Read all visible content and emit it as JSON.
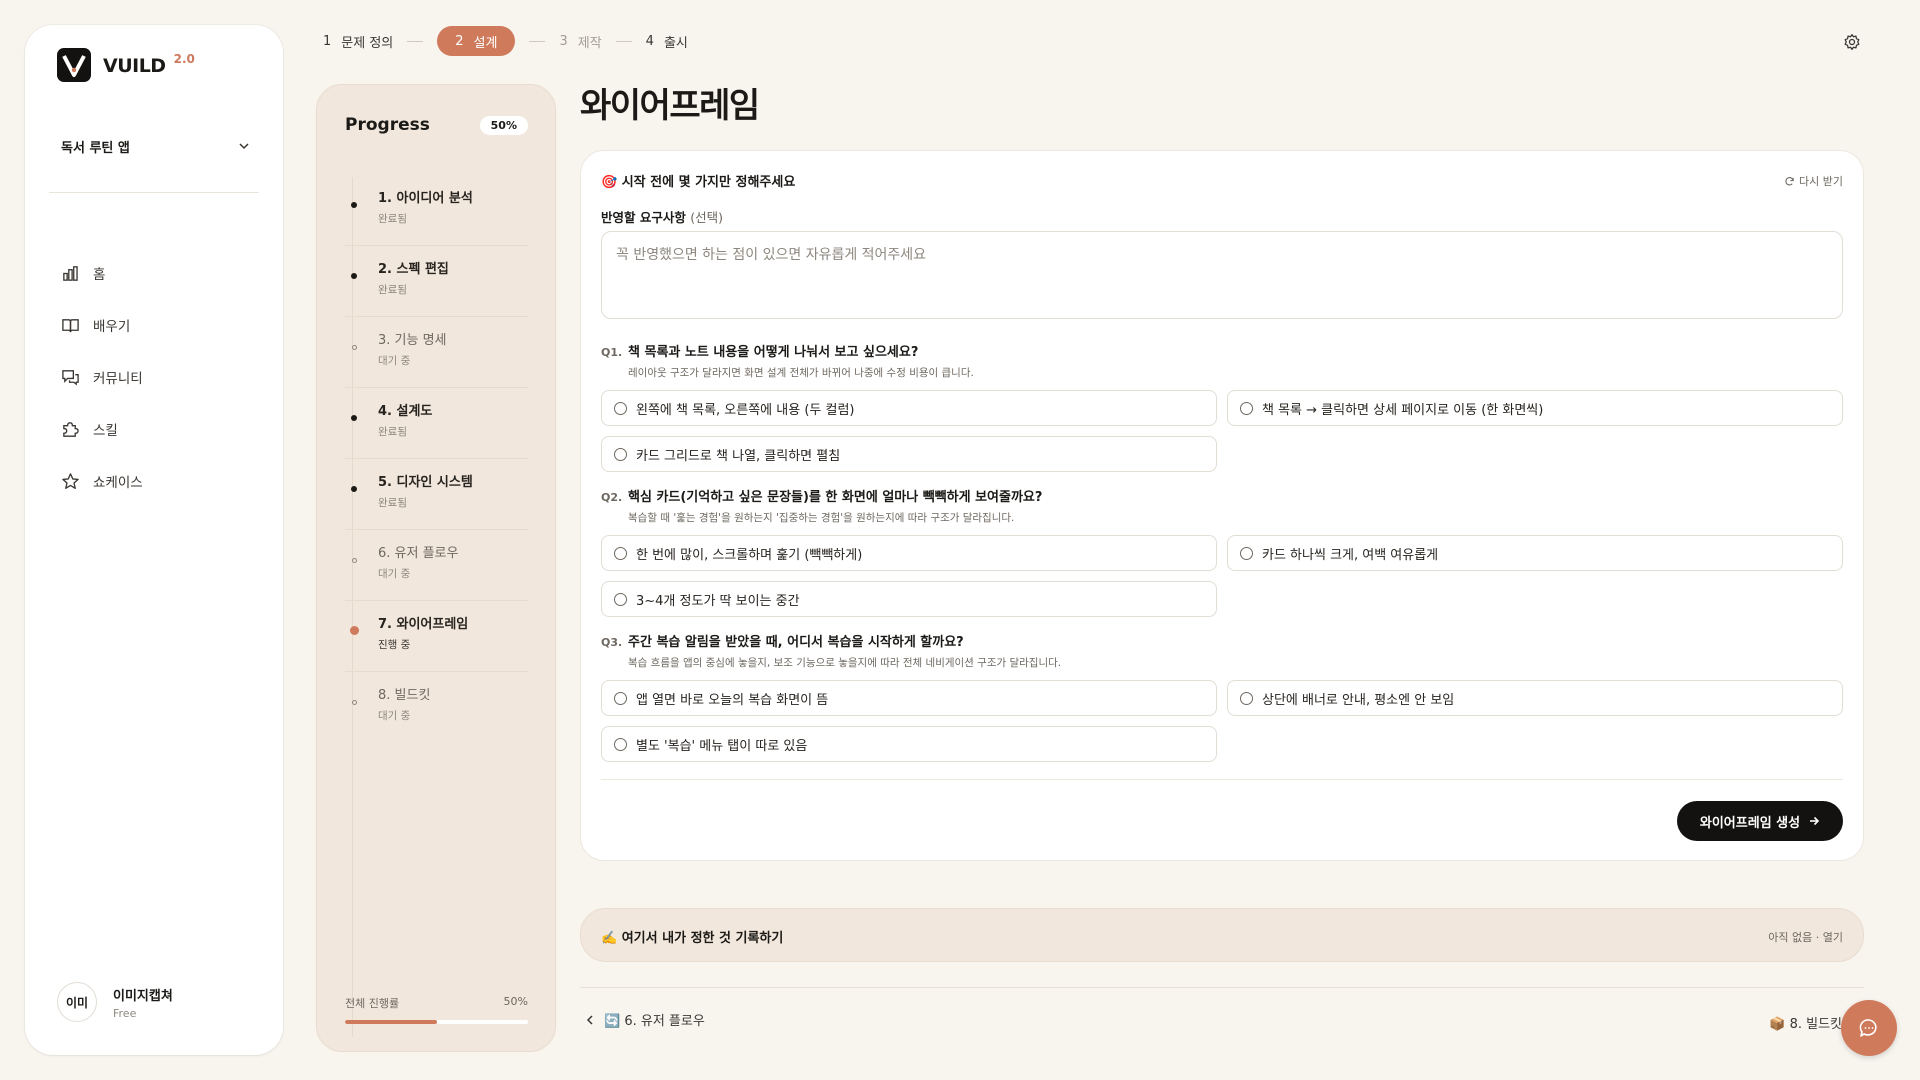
{
  "sidebar": {
    "logo_text": "VUILD",
    "logo_version": "2.0",
    "project": "독서 루틴 앱",
    "nav": [
      {
        "label": "홈",
        "icon": "chart-icon"
      },
      {
        "label": "배우기",
        "icon": "book-icon"
      },
      {
        "label": "커뮤니티",
        "icon": "chat-bubbles-icon"
      },
      {
        "label": "스킬",
        "icon": "puzzle-icon"
      },
      {
        "label": "쇼케이스",
        "icon": "star-icon"
      }
    ],
    "user": {
      "avatar": "이미",
      "name": "이미지캡쳐",
      "plan": "Free"
    }
  },
  "stepper": [
    {
      "num": "1",
      "label": "문제 정의"
    },
    {
      "num": "2",
      "label": "설계"
    },
    {
      "num": "3",
      "label": "제작"
    },
    {
      "num": "4",
      "label": "출시"
    }
  ],
  "progress": {
    "title": "Progress",
    "badge": "50%",
    "items": [
      {
        "name": "1. 아이디어 분석",
        "status": "완료됨",
        "state": "done"
      },
      {
        "name": "2. 스펙 편집",
        "status": "완료됨",
        "state": "done"
      },
      {
        "name": "3. 기능 명세",
        "status": "대기 중",
        "state": "pending"
      },
      {
        "name": "4. 설계도",
        "status": "완료됨",
        "state": "done"
      },
      {
        "name": "5. 디자인 시스템",
        "status": "완료됨",
        "state": "done"
      },
      {
        "name": "6. 유저 플로우",
        "status": "대기 중",
        "state": "pending"
      },
      {
        "name": "7. 와이어프레임",
        "status": "진행 중",
        "state": "current"
      },
      {
        "name": "8. 빌드킷",
        "status": "대기 중",
        "state": "pending"
      }
    ],
    "overall_label": "전체 진행률",
    "overall_value": "50%",
    "overall_fraction": 0.5
  },
  "main": {
    "title": "와이어프레임",
    "card_head": "🎯 시작 전에 몇 가지만 정해주세요",
    "regen": "다시 받기",
    "req_label": "반영할 요구사항",
    "req_optional": "(선택)",
    "req_placeholder": "꼭 반영했으면 하는 점이 있으면 자유롭게 적어주세요",
    "req_value": "",
    "questions": [
      {
        "num": "Q1.",
        "title": "책 목록과 노트 내용을 어떻게 나눠서 보고 싶으세요?",
        "desc": "레이아웃 구조가 달라지면 화면 설계 전체가 바뀌어 나중에 수정 비용이 큽니다.",
        "options": [
          "왼쪽에 책 목록, 오른쪽에 내용 (두 컬럼)",
          "책 목록 → 클릭하면 상세 페이지로 이동 (한 화면씩)",
          "카드 그리드로 책 나열, 클릭하면 펼침"
        ]
      },
      {
        "num": "Q2.",
        "title": "핵심 카드(기억하고 싶은 문장들)를 한 화면에 얼마나 빽빽하게 보여줄까요?",
        "desc": "복습할 때 '훑는 경험'을 원하는지 '집중하는 경험'을 원하는지에 따라 구조가 달라집니다.",
        "options": [
          "한 번에 많이, 스크롤하며 훑기 (빽빽하게)",
          "카드 하나씩 크게, 여백 여유롭게",
          "3~4개 정도가 딱 보이는 중간"
        ]
      },
      {
        "num": "Q3.",
        "title": "주간 복습 알림을 받았을 때, 어디서 복습을 시작하게 할까요?",
        "desc": "복습 흐름을 앱의 중심에 놓을지, 보조 기능으로 놓을지에 따라 전체 네비게이션 구조가 달라집니다.",
        "options": [
          "앱 열면 바로 오늘의 복습 화면이 뜸",
          "상단에 배너로 안내, 평소엔 안 보임",
          "별도 '복습' 메뉴 탭이 따로 있음"
        ]
      }
    ],
    "generate_button": "와이어프레임 생성",
    "note_title": "✍️ 여기서 내가 정한 것 기록하기",
    "note_meta": "아직 없음 · 열기",
    "prev_label": "🔄 6. 유저 플로우",
    "next_label": "📦 8. 빌드킷"
  },
  "colors": {
    "accent": "#d07a5c",
    "background": "#f8f5ef",
    "panel": "#f1e7dc",
    "dark_button": "#141210"
  }
}
